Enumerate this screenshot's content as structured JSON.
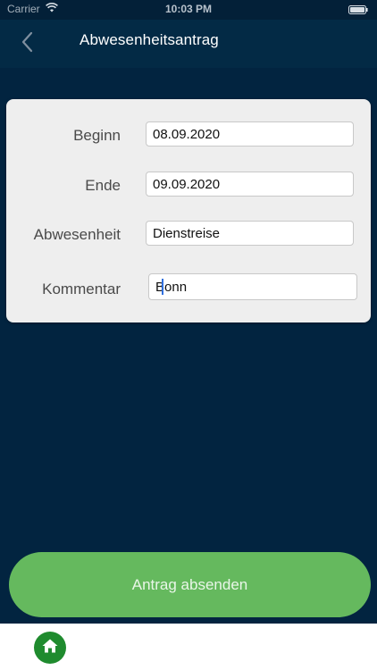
{
  "status_bar": {
    "carrier": "Carrier",
    "time": "10:03 PM"
  },
  "nav": {
    "title": "Abwesenheitsantrag",
    "back_icon": "chevron-left-icon"
  },
  "form": {
    "fields": [
      {
        "label": "Beginn",
        "value": "08.09.2020"
      },
      {
        "label": "Ende",
        "value": "09.09.2020"
      },
      {
        "label": "Abwesenheit",
        "value": "Dienstreise"
      },
      {
        "label": "Kommentar",
        "value": "Bonn"
      }
    ]
  },
  "submit": {
    "label": "Antrag absenden"
  },
  "tabbar": {
    "home_icon": "home-icon"
  },
  "colors": {
    "background": "#022440",
    "navbar": "#032a45",
    "card": "#eeeeee",
    "button": "#65b95e",
    "home_tab": "#1f8b2e"
  }
}
